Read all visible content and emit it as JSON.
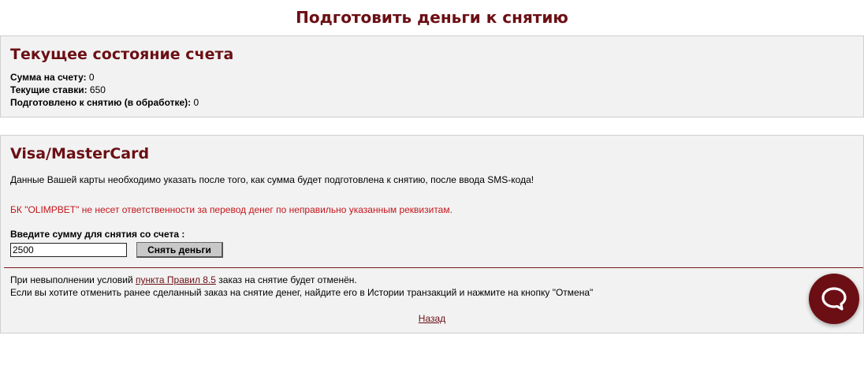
{
  "page": {
    "title": "Подготовить деньги к снятию"
  },
  "account": {
    "heading": "Текущее состояние счета",
    "balance_label": "Сумма на счету:",
    "balance_value": "0",
    "bets_label": "Текущие ставки:",
    "bets_value": "650",
    "prepared_label": "Подготовлено к снятию (в обработке):",
    "prepared_value": "0"
  },
  "card": {
    "heading": "Visa/MasterCard",
    "info_text": "Данные Вашей карты необходимо указать после того, как сумма будет подготовлена к снятию, после ввода SMS-кода!",
    "warning_text": "БК \"OLIMPBET\" не несет ответственности за перевод денег по неправильно указанным реквизитам.",
    "amount_label": "Введите сумму для снятия со счета :",
    "amount_value": "2500",
    "withdraw_button": "Снять деньги",
    "rules_prefix": "При невыполнении условий ",
    "rules_link": "пункта Правил 8.5",
    "rules_suffix": " заказ на снятие будет отменён.",
    "cancel_text": "Если вы хотите отменить ранее сделанный заказ на снятие денег, найдите его в Истории транзакций и нажмите на кнопку \"Отмена\"",
    "back_link": "Назад"
  },
  "chat": {
    "icon": "chat-bubble-icon",
    "accent_color": "#6b0f14"
  }
}
